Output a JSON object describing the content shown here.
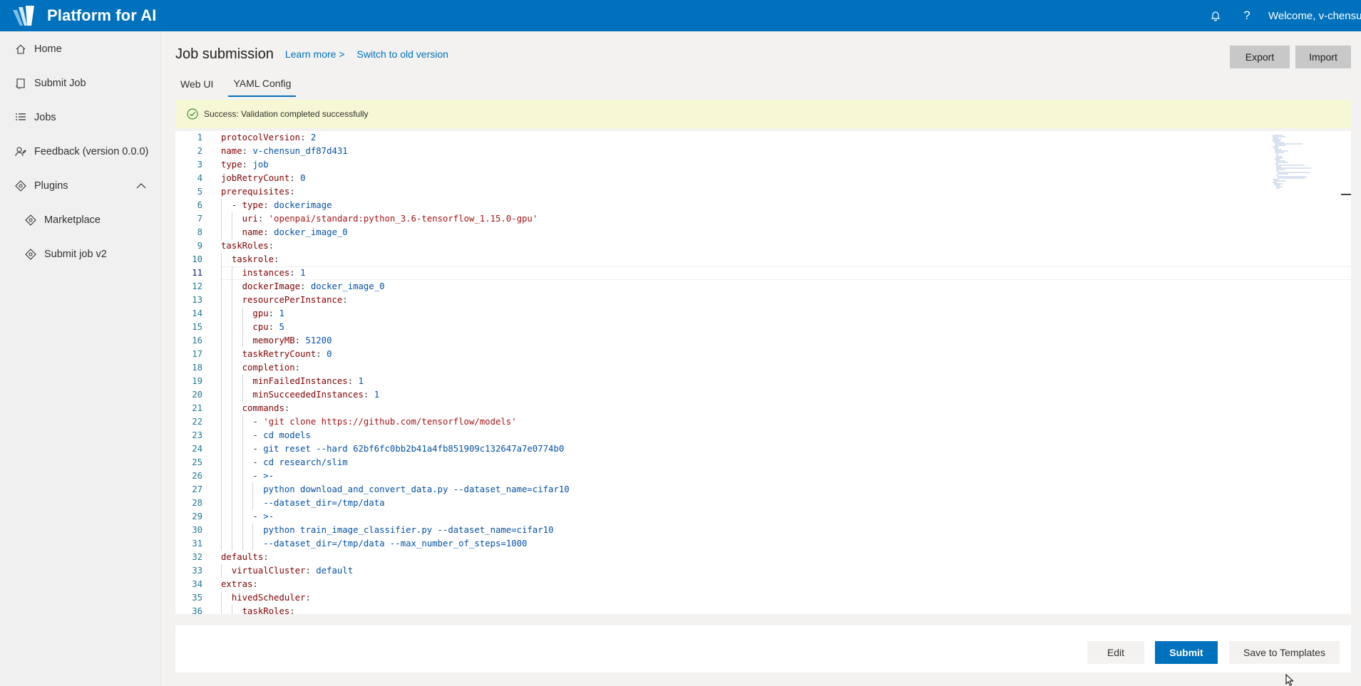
{
  "app": {
    "title": "Platform for AI",
    "welcome": "Welcome, v-chensun"
  },
  "sidebar": {
    "items": [
      {
        "label": "Home",
        "icon": "home-icon"
      },
      {
        "label": "Submit Job",
        "icon": "submit-job-icon"
      },
      {
        "label": "Jobs",
        "icon": "list-icon"
      },
      {
        "label": "Feedback (version 0.0.0)",
        "icon": "feedback-icon"
      },
      {
        "label": "Plugins",
        "icon": "puzzle-icon"
      },
      {
        "label": "Marketplace",
        "icon": "puzzle-icon"
      },
      {
        "label": "Submit job v2",
        "icon": "puzzle-icon"
      }
    ]
  },
  "header": {
    "title": "Job submission",
    "learn_more": "Learn more >",
    "switch_version": "Switch to old version",
    "export_label": "Export",
    "import_label": "Import"
  },
  "tabs": [
    {
      "label": "Web UI"
    },
    {
      "label": "YAML Config"
    }
  ],
  "banner": {
    "text": "Success: Validation completed successfully"
  },
  "editor": {
    "current_line": 11,
    "lines": [
      "protocolVersion: 2",
      "name: v-chensun_df87d431",
      "type: job",
      "jobRetryCount: 0",
      "prerequisites:",
      "  - type: dockerimage",
      "    uri: 'openpai/standard:python_3.6-tensorflow_1.15.0-gpu'",
      "    name: docker_image_0",
      "taskRoles:",
      "  taskrole:",
      "    instances: 1",
      "    dockerImage: docker_image_0",
      "    resourcePerInstance:",
      "      gpu: 1",
      "      cpu: 5",
      "      memoryMB: 51200",
      "    taskRetryCount: 0",
      "    completion:",
      "      minFailedInstances: 1",
      "      minSucceededInstances: 1",
      "    commands:",
      "      - 'git clone https://github.com/tensorflow/models'",
      "      - cd models",
      "      - git reset --hard 62bf6fc0bb2b41a4fb851909c132647a7e0774b0",
      "      - cd research/slim",
      "      - >-",
      "        python download_and_convert_data.py --dataset_name=cifar10",
      "        --dataset_dir=/tmp/data",
      "      - >-",
      "        python train_image_classifier.py --dataset_name=cifar10",
      "        --dataset_dir=/tmp/data --max_number_of_steps=1000",
      "defaults:",
      "  virtualCluster: default",
      "extras:",
      "  hivedScheduler:",
      "    taskRoles:"
    ]
  },
  "footer": {
    "edit_label": "Edit",
    "submit_label": "Submit",
    "save_label": "Save to Templates"
  },
  "colors": {
    "brand": "#0071bc",
    "banner_bg": "#f6f7d4",
    "key": "#800000",
    "value": "#0451a5",
    "line_number": "#237893"
  }
}
